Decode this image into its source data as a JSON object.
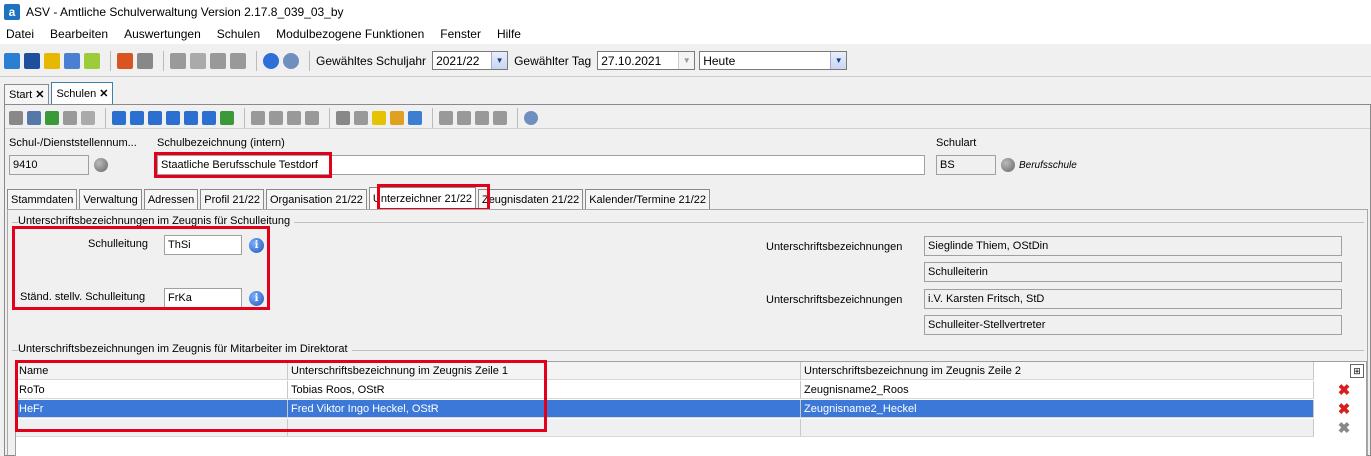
{
  "titlebar": {
    "icon_letter": "a",
    "title": "ASV - Amtliche Schulverwaltung Version 2.17.8_039_03_by"
  },
  "menu": [
    "Datei",
    "Bearbeiten",
    "Auswertungen",
    "Schulen",
    "Modulbezogene Funktionen",
    "Fenster",
    "Hilfe"
  ],
  "toolbar": {
    "schuljahr_label": "Gewähltes Schuljahr",
    "schuljahr_value": "2021/22",
    "tag_label": "Gewählter Tag",
    "tag_value": "27.10.2021",
    "heute_value": "Heute"
  },
  "doc_tabs": [
    {
      "label": "Start"
    },
    {
      "label": "Schulen"
    }
  ],
  "header": {
    "schulnummer_label": "Schul-/Dienststellennum...",
    "schulnummer_value": "9410",
    "schulbezeichnung_label": "Schulbezeichnung (intern)",
    "schulbezeichnung_value": "Staatliche Berufsschule Testdorf",
    "schulart_label": "Schulart",
    "schulart_value": "BS",
    "schulart_text": "Berufsschule"
  },
  "sub_tabs": [
    "Stammdaten",
    "Verwaltung",
    "Adressen",
    "Profil 21/22",
    "Organisation 21/22",
    "Unterzeichner 21/22",
    "Zeugnisdaten 21/22",
    "Kalender/Termine 21/22"
  ],
  "leitung_group": {
    "title": "Unterschriftsbezeichnungen im Zeugnis für Schulleitung",
    "schulleitung_label": "Schulleitung",
    "schulleitung_value": "ThSi",
    "stellv_label": "Ständ. stellv. Schulleitung",
    "stellv_value": "FrKa",
    "bez_label_1": "Unterschriftsbezeichnungen",
    "bez_value_1a": "Sieglinde Thiem, OStDin",
    "bez_value_1b": "Schulleiterin",
    "bez_label_2": "Unterschriftsbezeichnungen",
    "bez_value_2a": "i.V. Karsten Fritsch, StD",
    "bez_value_2b": "Schulleiter-Stellvertreter"
  },
  "direktorat_group": {
    "title": "Unterschriftsbezeichnungen im Zeugnis für Mitarbeiter im Direktorat",
    "columns": [
      "Name",
      "Unterschriftsbezeichnung im Zeugnis Zeile 1",
      "Unterschriftsbezeichnung im Zeugnis Zeile 2"
    ],
    "rows": [
      {
        "name": "RoTo",
        "zeile1": "Tobias Roos, OStR",
        "zeile2": "Zeugnisname2_Roos"
      },
      {
        "name": "HeFr",
        "zeile1": "Fred Viktor Ingo Heckel, OStR",
        "zeile2": "Zeugnisname2_Heckel"
      }
    ]
  },
  "colors": {
    "highlight": "#e3001b",
    "selection": "#3c78d8"
  }
}
